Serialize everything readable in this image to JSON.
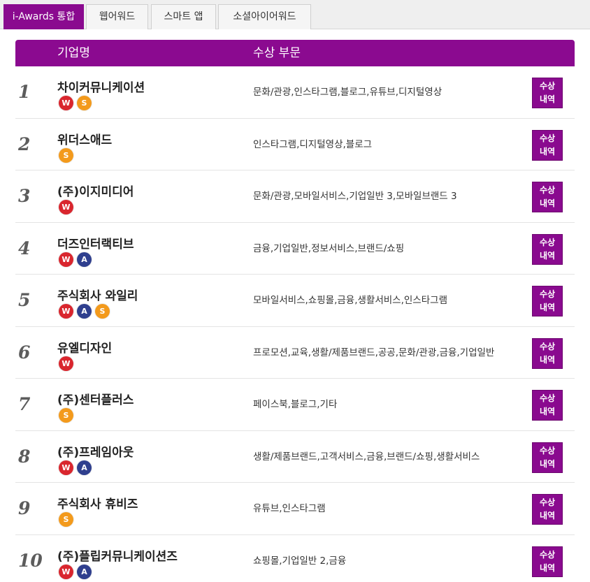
{
  "tabs": [
    {
      "label": "i-Awards 통합",
      "active": true
    },
    {
      "label": "웹어워드",
      "active": false
    },
    {
      "label": "스마트 앱",
      "active": false
    },
    {
      "label": "소셜아이어워드",
      "active": false
    }
  ],
  "table": {
    "header_company": "기업명",
    "header_category": "수상 부문",
    "award_button_line1": "수상",
    "award_button_line2": "내역"
  },
  "badge_labels": {
    "w": "W",
    "a": "A",
    "s": "S"
  },
  "colors": {
    "accent": "#8a0a8f",
    "badge_w": "#d9262e",
    "badge_a": "#2f3f8e",
    "badge_s": "#f39a1c"
  },
  "rows": [
    {
      "rank": "1",
      "company": "차이커뮤니케이션",
      "badges": [
        "w",
        "s"
      ],
      "categories": "문화/관광,인스타그램,블로그,유튜브,디지털영상"
    },
    {
      "rank": "2",
      "company": "위더스애드",
      "badges": [
        "s"
      ],
      "categories": "인스타그램,디지털영상,블로그"
    },
    {
      "rank": "3",
      "company": "(주)이지미디어",
      "badges": [
        "w"
      ],
      "categories": "문화/관광,모바일서비스,기업일반 3,모바일브랜드 3"
    },
    {
      "rank": "4",
      "company": "더즈인터랙티브",
      "badges": [
        "w",
        "a"
      ],
      "categories": "금융,기업일반,정보서비스,브랜드/쇼핑"
    },
    {
      "rank": "5",
      "company": "주식회사 와일리",
      "badges": [
        "w",
        "a",
        "s"
      ],
      "categories": "모바일서비스,쇼핑몰,금융,생활서비스,인스타그램"
    },
    {
      "rank": "6",
      "company": "유엘디자인",
      "badges": [
        "w"
      ],
      "categories": "프로모션,교육,생활/제품브랜드,공공,문화/관광,금융,기업일반"
    },
    {
      "rank": "7",
      "company": "(주)센터플러스",
      "badges": [
        "s"
      ],
      "categories": "페이스북,블로그,기타"
    },
    {
      "rank": "8",
      "company": "(주)프레임아웃",
      "badges": [
        "w",
        "a"
      ],
      "categories": "생활/제품브랜드,고객서비스,금융,브랜드/쇼핑,생활서비스"
    },
    {
      "rank": "9",
      "company": "주식회사 휴비즈",
      "badges": [
        "s"
      ],
      "categories": "유튜브,인스타그램"
    },
    {
      "rank": "10",
      "company": "(주)플립커뮤니케이션즈",
      "badges": [
        "w",
        "a"
      ],
      "categories": "쇼핑몰,기업일반 2,금융"
    }
  ]
}
